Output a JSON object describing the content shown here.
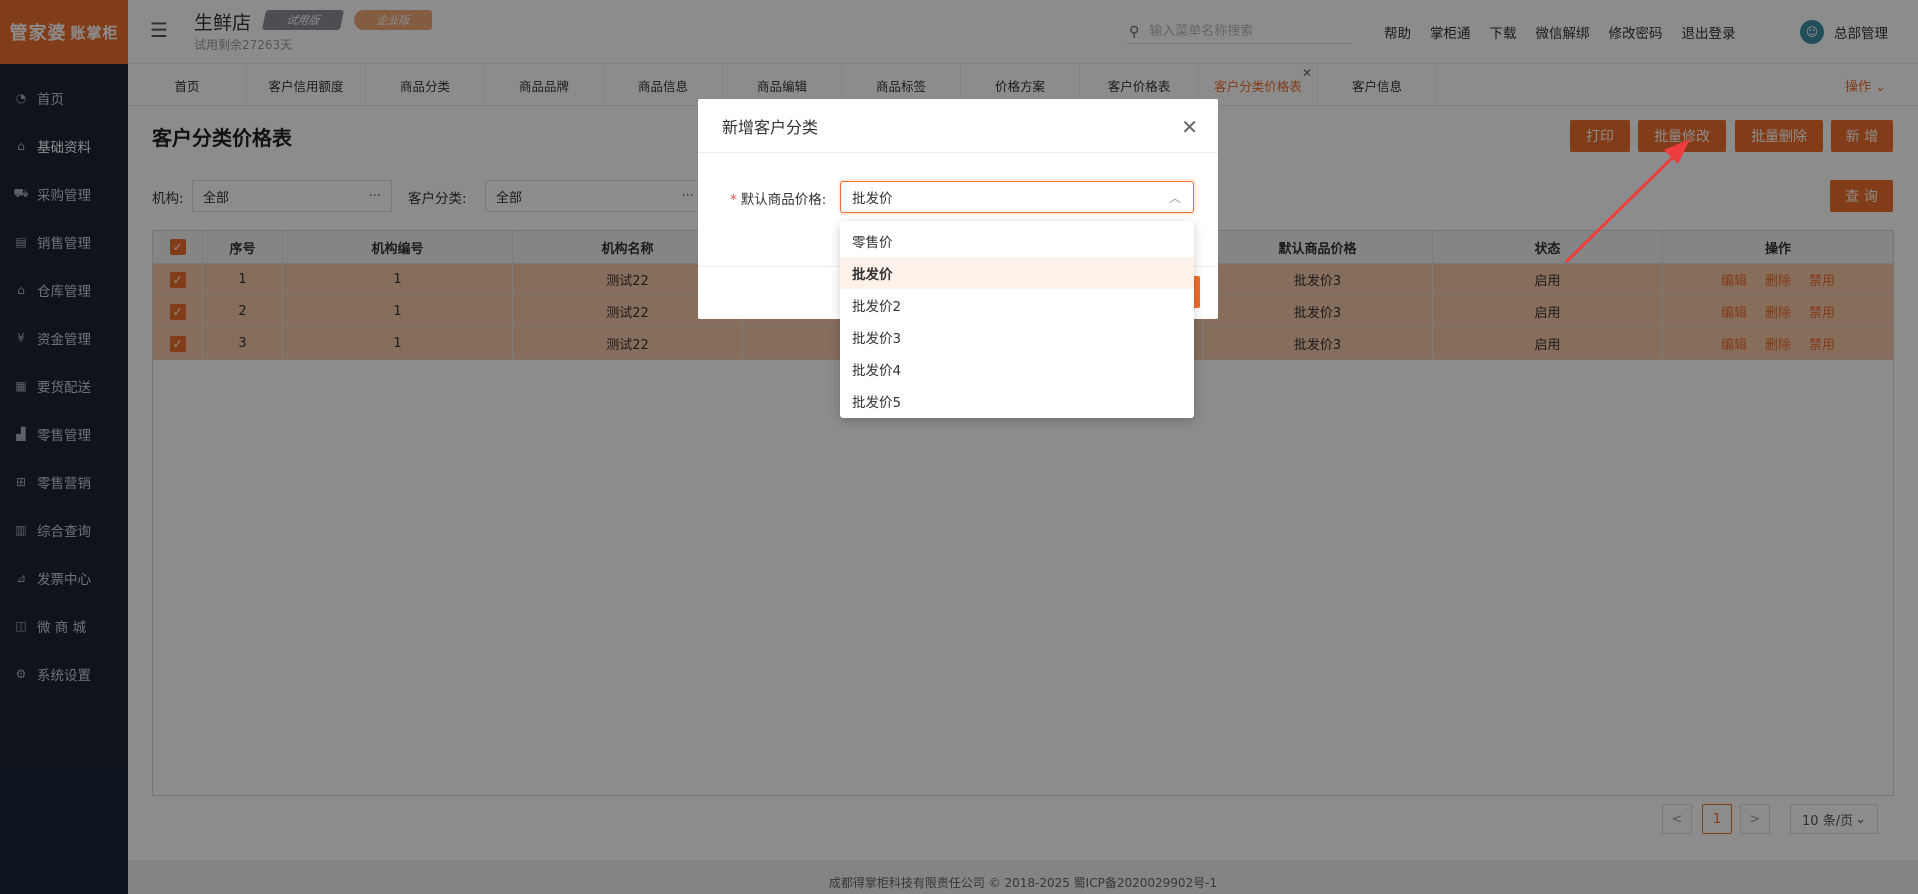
{
  "app": {
    "logo_text": "管家婆",
    "logo_sub": "账掌柜",
    "shop_name": "生鲜店",
    "trial_badge": "试用版",
    "edition_badge": "企业版",
    "trial_days": "试用剩余27263天"
  },
  "sidebar": {
    "items": [
      {
        "label": "首页",
        "icon": "speedometer-icon"
      },
      {
        "label": "基础资料",
        "icon": "home-icon"
      },
      {
        "label": "采购管理",
        "icon": "cart-icon"
      },
      {
        "label": "销售管理",
        "icon": "sales-icon"
      },
      {
        "label": "仓库管理",
        "icon": "warehouse-icon"
      },
      {
        "label": "资金管理",
        "icon": "fund-icon"
      },
      {
        "label": "要货配送",
        "icon": "document-icon"
      },
      {
        "label": "零售管理",
        "icon": "chart-icon"
      },
      {
        "label": "零售营销",
        "icon": "gift-icon"
      },
      {
        "label": "综合查询",
        "icon": "bar-chart-icon"
      },
      {
        "label": "发票中心",
        "icon": "invoice-icon"
      },
      {
        "label": "微 商 城",
        "icon": "bag-icon"
      },
      {
        "label": "系统设置",
        "icon": "gear-icon"
      }
    ]
  },
  "header": {
    "search_placeholder": "输入菜单名称搜索",
    "links": [
      "帮助",
      "掌柜通",
      "下载",
      "微信解绑",
      "修改密码",
      "退出登录"
    ],
    "user_name": "总部管理"
  },
  "tabs": {
    "items": [
      "首页",
      "客户信用额度",
      "商品分类",
      "商品品牌",
      "商品信息",
      "商品编辑",
      "商品标签",
      "价格方案",
      "客户价格表",
      "客户分类价格表",
      "客户信息"
    ],
    "active_index": 9,
    "ops_label": "操作"
  },
  "page": {
    "title": "客户分类价格表",
    "buttons": {
      "print": "打印",
      "batch_edit": "批量修改",
      "batch_delete": "批量删除",
      "add": "新 增",
      "query": "查 询"
    },
    "filters": {
      "org_label": "机构:",
      "org_value": "全部",
      "category_label": "客户分类:",
      "category_value": "全部"
    }
  },
  "table": {
    "columns": [
      "序号",
      "机构编号",
      "机构名称",
      "",
      "",
      "默认商品价格",
      "状态",
      "操作"
    ],
    "rows": [
      {
        "seq": "1",
        "org_code": "1",
        "org_name": "测试22",
        "price": "批发价3",
        "status": "启用"
      },
      {
        "seq": "2",
        "org_code": "1",
        "org_name": "测试22",
        "price": "批发价3",
        "status": "启用"
      },
      {
        "seq": "3",
        "org_code": "1",
        "org_name": "测试22",
        "price": "批发价3",
        "status": "启用"
      }
    ],
    "row_ops": [
      "编辑",
      "删除",
      "禁用"
    ]
  },
  "pagination": {
    "prev": "<",
    "current": "1",
    "next": ">",
    "page_size": "10 条/页"
  },
  "footer": {
    "text": "成都得掌柜科技有限责任公司 © 2018-2025 蜀ICP备2020029902号-1"
  },
  "modal": {
    "title": "新增客户分类",
    "field_label": "默认商品价格:",
    "field_value": "批发价",
    "options": [
      "零售价",
      "批发价",
      "批发价2",
      "批发价3",
      "批发价4",
      "批发价5"
    ],
    "selected_index": 1
  },
  "colors": {
    "accent": "#ef6d2d",
    "sidebar_bg": "#1a2434",
    "annotation_arrow": "#f03c3c"
  }
}
